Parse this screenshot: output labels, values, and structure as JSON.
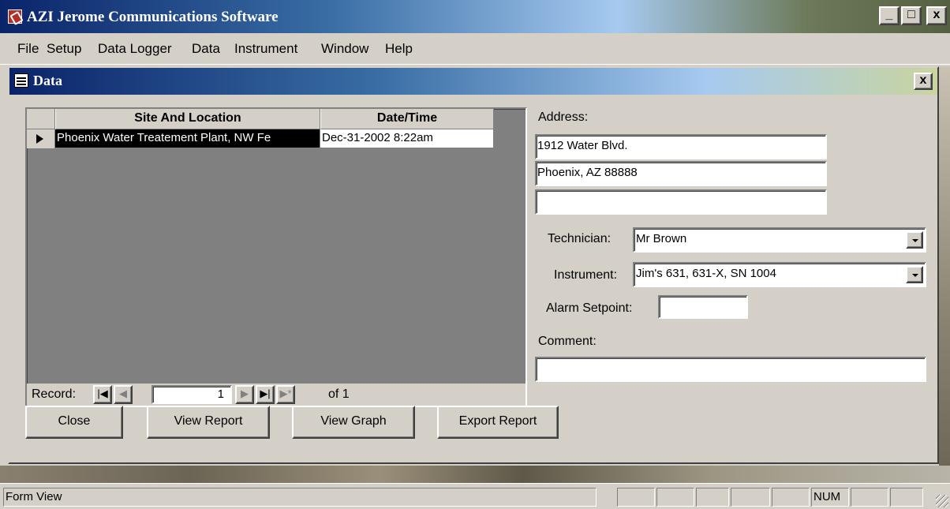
{
  "app": {
    "title": "AZI Jerome Communications Software",
    "minimize": "_",
    "maximize": "□",
    "close": "x"
  },
  "menu": {
    "file": "File",
    "setup": "Setup",
    "data_logger": "Data Logger",
    "data": "Data",
    "instrument": "Instrument",
    "window": "Window",
    "help": "Help"
  },
  "data_window": {
    "title": "Data",
    "close": "x"
  },
  "datasheet": {
    "columns": [
      "Site And Location",
      "Date/Time"
    ],
    "rows": [
      {
        "site": "Phoenix Water Treatement Plant, NW Fe",
        "datetime": "Dec-31-2002 8:22am"
      }
    ]
  },
  "navigation": {
    "record_label": "Record:",
    "first": "|◀",
    "prev": "◀",
    "current": "1",
    "next": "▶",
    "last": "▶|",
    "new": "▶*",
    "of_label": "of 1"
  },
  "form": {
    "address_label": "Address:",
    "address_line1": "1912 Water Blvd.",
    "address_line2": "Phoenix, AZ 88888",
    "address_line3": "",
    "technician_label": "Technician:",
    "technician_value": "Mr Brown",
    "instrument_label": "Instrument:",
    "instrument_value": "Jim's 631, 631-X, SN 1004",
    "alarm_label": "Alarm Setpoint:",
    "alarm_value": "",
    "comment_label": "Comment:",
    "comment_value": ""
  },
  "buttons": {
    "close": "Close",
    "view_report": "View Report",
    "view_graph": "View Graph",
    "export_report": "Export Report"
  },
  "status": {
    "mode": "Form View",
    "num": "NUM"
  }
}
